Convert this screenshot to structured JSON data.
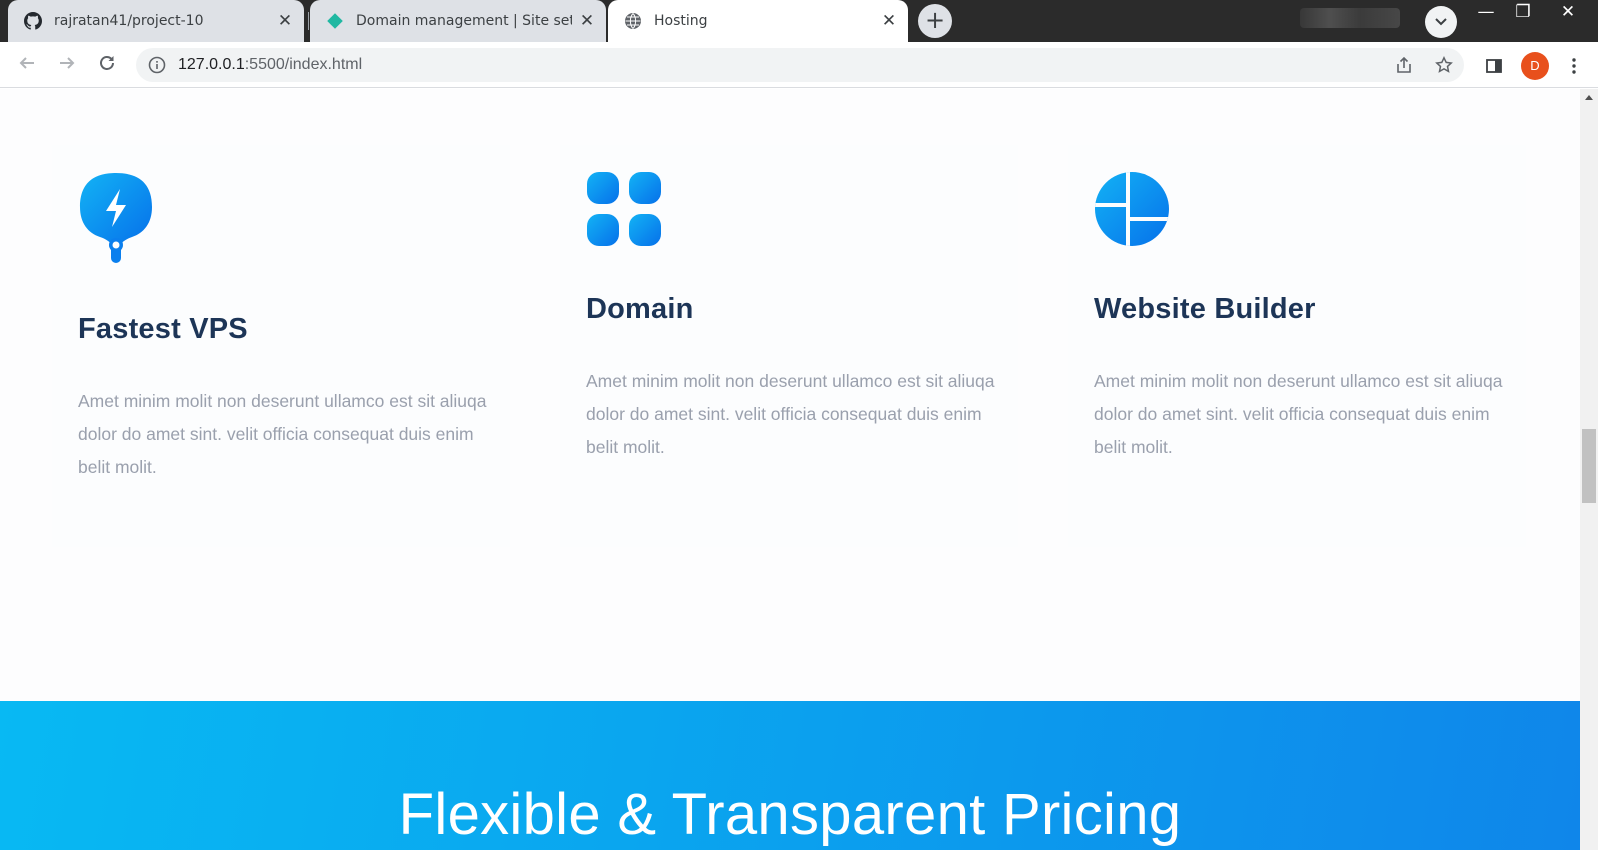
{
  "browser": {
    "tabs": [
      {
        "title": "rajratan41/project-10",
        "favicon": "github-icon"
      },
      {
        "title": "Domain management | Site settin",
        "favicon": "netlify-diamond-icon"
      },
      {
        "title": "Hosting",
        "favicon": "globe-icon"
      }
    ],
    "close_glyph": "✕",
    "new_tab_glyph": "+",
    "url_host": "127.0.0.1",
    "url_path": ":5500/index.html",
    "profile_initial": "D",
    "window_controls": {
      "minimize": "—",
      "restore": "❐",
      "close": "✕"
    }
  },
  "features": [
    {
      "title": "Fastest VPS",
      "icon": "lightning-bulb-icon",
      "description": "Amet minim molit non deserunt ullamco est sit aliuqa dolor do amet sint. velit officia consequat duis enim belit molit."
    },
    {
      "title": "Domain",
      "icon": "grid-icon",
      "description": "Amet minim molit non deserunt ullamco est sit aliuqa dolor do amet sint. velit officia consequat duis enim belit molit."
    },
    {
      "title": "Website Builder",
      "icon": "pie-layout-icon",
      "description": "Amet minim molit non deserunt ullamco est sit aliuqa dolor do amet sint. velit officia consequat duis enim belit molit."
    }
  ],
  "pricing": {
    "heading": "Flexible & Transparent Pricing"
  },
  "colors": {
    "heading": "#1d3557",
    "body_text": "#9aa0ad",
    "accent_blue": "#0a8cf0",
    "pricing_gradient_start": "#08b9f3",
    "pricing_gradient_end": "#0f86ea",
    "profile_avatar": "#e8501c"
  }
}
